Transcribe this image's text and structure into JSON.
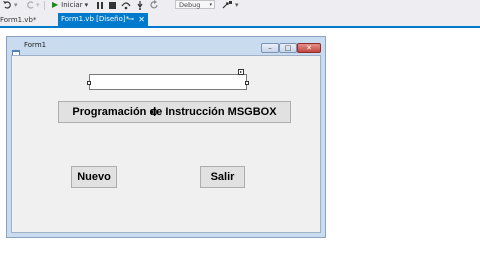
{
  "toolbar": {
    "start_label": "Iniciar",
    "debug_config": "Debug"
  },
  "tabs": [
    {
      "label": "Form1.vb*"
    },
    {
      "label": "Form1.vb [Diseño]*"
    }
  ],
  "form": {
    "title": "Form1",
    "textbox_value": "",
    "msgbox_button": "Programación de Instrucción MSGBOX",
    "nuevo_button": "Nuevo",
    "salir_button": "Salir"
  },
  "colors": {
    "accent": "#007acc",
    "form_border": "#c9dbef",
    "close_button": "#c0473f"
  }
}
